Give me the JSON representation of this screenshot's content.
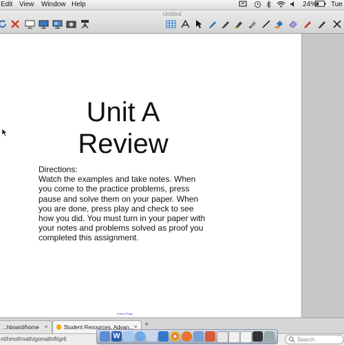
{
  "menubar": {
    "items": [
      "Edit",
      "View",
      "Window",
      "Help"
    ],
    "battery": "24%",
    "clock": "Tue"
  },
  "window": {
    "title": "Untitled"
  },
  "toolbar": {
    "left_icons": [
      "refresh-icon",
      "close-x-icon",
      "screen-icon",
      "monitor-icon",
      "monitor-dual-icon",
      "camera-icon",
      "tripod-icon"
    ],
    "right_icons": [
      "table-icon",
      "text-tool-icon",
      "pointer-icon",
      "pen-icon",
      "marker-icon",
      "highlighter-icon",
      "eraser-icon",
      "line-icon",
      "fill-icon",
      "shape-eraser-icon",
      "pen-red-icon",
      "pencil-icon",
      "close-x-icon"
    ]
  },
  "slide": {
    "title_line1": "Unit A",
    "title_line2": "Review",
    "directions_heading": "Directions:",
    "directions_body": "Watch the examples and take notes. When you come to the practice problems, press pause and solve them on your paper. When you are done, press play and check to see how you did. You must turn in your paper with your notes and problems solved as proof you completed this assignment.",
    "footer_link": "Extend Page"
  },
  "browser": {
    "tabs": [
      {
        "label": "...hboard/home"
      },
      {
        "label": "Student Resources, Advan..."
      }
    ],
    "new_tab": "+",
    "tab_close": "✕",
    "url": "nt/hmof/math/gomath/fl/gr6",
    "search_placeholder": "Search"
  }
}
